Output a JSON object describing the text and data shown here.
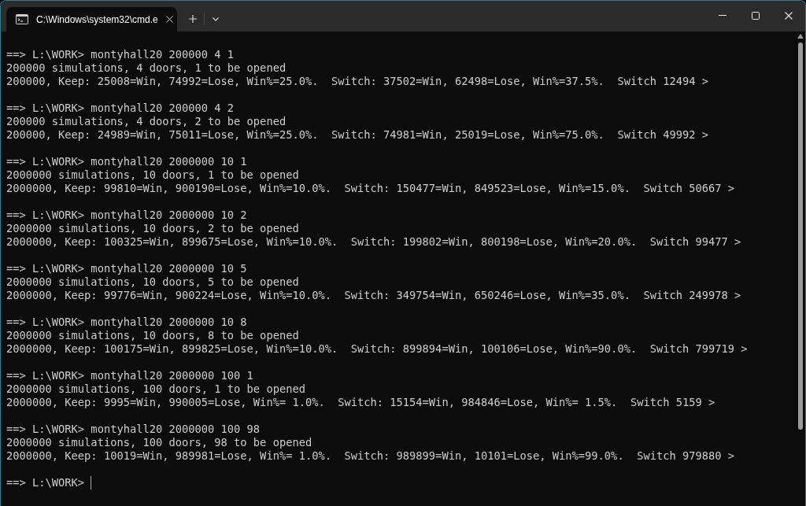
{
  "window": {
    "tab": {
      "title": "C:\\Windows\\system32\\cmd.e",
      "selected": true
    }
  },
  "terminal": {
    "blocks": [
      {
        "command": "==> L:\\WORK> montyhall20 200000 4 1",
        "output": [
          "200000 simulations, 4 doors, 1 to be opened",
          "200000, Keep: 25008=Win, 74992=Lose, Win%=25.0%.  Switch: 37502=Win, 62498=Lose, Win%=37.5%.  Switch 12494 >"
        ]
      },
      {
        "command": "==> L:\\WORK> montyhall20 200000 4 2",
        "output": [
          "200000 simulations, 4 doors, 2 to be opened",
          "200000, Keep: 24989=Win, 75011=Lose, Win%=25.0%.  Switch: 74981=Win, 25019=Lose, Win%=75.0%.  Switch 49992 >"
        ]
      },
      {
        "command": "==> L:\\WORK> montyhall20 2000000 10 1",
        "output": [
          "2000000 simulations, 10 doors, 1 to be opened",
          "2000000, Keep: 99810=Win, 900190=Lose, Win%=10.0%.  Switch: 150477=Win, 849523=Lose, Win%=15.0%.  Switch 50667 >"
        ]
      },
      {
        "command": "==> L:\\WORK> montyhall20 2000000 10 2",
        "output": [
          "2000000 simulations, 10 doors, 2 to be opened",
          "2000000, Keep: 100325=Win, 899675=Lose, Win%=10.0%.  Switch: 199802=Win, 800198=Lose, Win%=20.0%.  Switch 99477 >"
        ]
      },
      {
        "command": "==> L:\\WORK> montyhall20 2000000 10 5",
        "output": [
          "2000000 simulations, 10 doors, 5 to be opened",
          "2000000, Keep: 99776=Win, 900224=Lose, Win%=10.0%.  Switch: 349754=Win, 650246=Lose, Win%=35.0%.  Switch 249978 >"
        ]
      },
      {
        "command": "==> L:\\WORK> montyhall20 2000000 10 8",
        "output": [
          "2000000 simulations, 10 doors, 8 to be opened",
          "2000000, Keep: 100175=Win, 899825=Lose, Win%=10.0%.  Switch: 899894=Win, 100106=Lose, Win%=90.0%.  Switch 799719 >"
        ]
      },
      {
        "command": "==> L:\\WORK> montyhall20 2000000 100 1",
        "output": [
          "2000000 simulations, 100 doors, 1 to be opened",
          "2000000, Keep: 9995=Win, 990005=Lose, Win%= 1.0%.  Switch: 15154=Win, 984846=Lose, Win%= 1.5%.  Switch 5159 >"
        ]
      },
      {
        "command": "==> L:\\WORK> montyhall20 2000000 100 98",
        "output": [
          "2000000 simulations, 100 doors, 98 to be opened",
          "2000000, Keep: 10019=Win, 989981=Lose, Win%= 1.0%.  Switch: 989899=Win, 10101=Lose, Win%=99.0%.  Switch 979880 >"
        ]
      }
    ],
    "prompt": {
      "text": "==> L:\\WORK>",
      "cursor_visible": true
    }
  }
}
